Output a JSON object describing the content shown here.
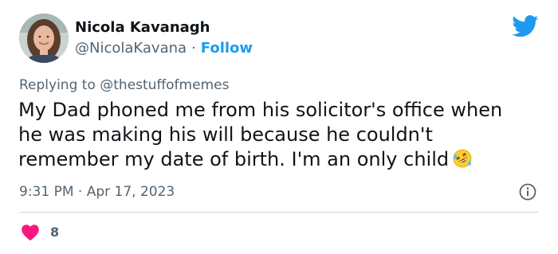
{
  "author": {
    "name": "Nicola Kavanagh",
    "handle": "@NicolaKavana",
    "separator": "·",
    "follow_label": "Follow"
  },
  "reply": {
    "prefix": "Replying to",
    "mention": "@thestuffofmemes"
  },
  "tweet": {
    "lines": [
      "My Dad phoned me from his solicitor's office when",
      "he was making his will because he couldn't",
      "remember my date of birth. I'm an only child"
    ],
    "emoji": "rolling-on-the-floor-laughing"
  },
  "meta": {
    "timestamp": "9:31 PM · Apr 17, 2023"
  },
  "engagement": {
    "likes": "8"
  },
  "colors": {
    "accent": "#1d9bf0",
    "heart": "#f91880",
    "secondary_text": "#536471",
    "primary_text": "#0f1419"
  },
  "icons": {
    "brand": "twitter-bird-icon",
    "info": "info-icon",
    "like": "heart-icon"
  }
}
